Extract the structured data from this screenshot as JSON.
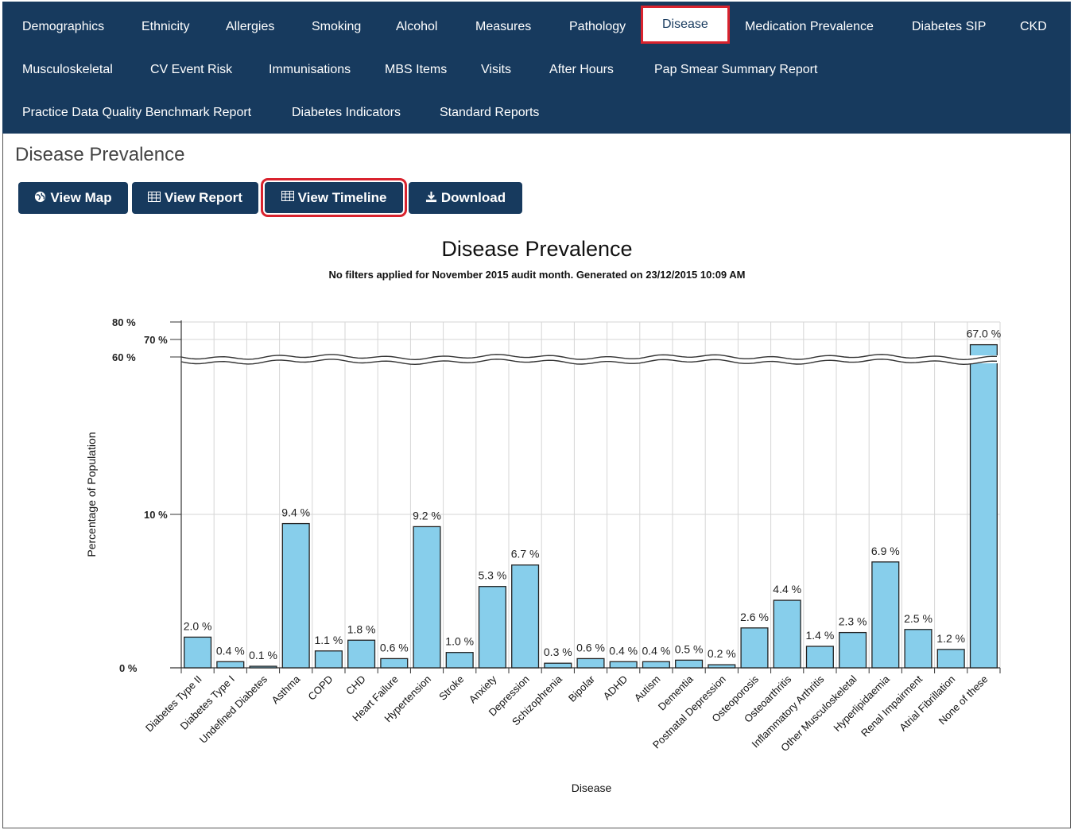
{
  "nav": {
    "row1": [
      "Demographics",
      "Ethnicity",
      "Allergies",
      "Smoking",
      "Alcohol",
      "Measures",
      "Pathology",
      "Disease",
      "Medication Prevalence",
      "Diabetes SIP",
      "CKD"
    ],
    "row2": [
      "Musculoskeletal",
      "CV Event Risk",
      "Immunisations",
      "MBS Items",
      "Visits",
      "After Hours",
      "Pap Smear Summary Report"
    ],
    "row3": [
      "Practice Data Quality Benchmark Report",
      "Diabetes Indicators",
      "Standard Reports"
    ],
    "active": "Disease"
  },
  "page": {
    "title": "Disease Prevalence"
  },
  "buttons": {
    "view_map": "View Map",
    "view_report": "View Report",
    "view_timeline": "View Timeline",
    "download": "Download"
  },
  "icons": {
    "view_map": "globe-icon",
    "view_report": "table-icon",
    "view_timeline": "table-icon",
    "download": "download-icon"
  },
  "colors": {
    "navbar": "#173a5e",
    "highlight": "#d9232e",
    "bar": "#87ceeb"
  },
  "chart_data": {
    "type": "bar",
    "title": "Disease Prevalence",
    "subtitle": "No filters applied for November 2015 audit month. Generated on 23/12/2015 10:09 AM",
    "xlabel": "Disease",
    "ylabel": "Percentage of Population",
    "y_axis_break": true,
    "yticks": [
      "0 %",
      "10 %",
      "60 %",
      "70 %",
      "80 %"
    ],
    "ylim": [
      0,
      80
    ],
    "grid": true,
    "categories": [
      "Diabetes Type II",
      "Diabetes Type I",
      "Undefined Diabetes",
      "Asthma",
      "COPD",
      "CHD",
      "Heart Failure",
      "Hypertension",
      "Stroke",
      "Anxiety",
      "Depression",
      "Schizophrenia",
      "Bipolar",
      "ADHD",
      "Autism",
      "Dementia",
      "Postnatal Depression",
      "Osteoporosis",
      "Osteoarthritis",
      "Inflammatory Arthritis",
      "Other Musculoskeletal",
      "Hyperlipidaemia",
      "Renal Impairment",
      "Atrial Fibrillation",
      "None of these"
    ],
    "values": [
      2.0,
      0.4,
      0.1,
      9.4,
      1.1,
      1.8,
      0.6,
      9.2,
      1.0,
      5.3,
      6.7,
      0.3,
      0.6,
      0.4,
      0.4,
      0.5,
      0.2,
      2.6,
      4.4,
      1.4,
      2.3,
      6.9,
      2.5,
      1.2,
      67.0
    ],
    "labels": [
      "2.0 %",
      "0.4 %",
      "0.1 %",
      "9.4 %",
      "1.1 %",
      "1.8 %",
      "0.6 %",
      "9.2 %",
      "1.0 %",
      "5.3 %",
      "6.7 %",
      "0.3 %",
      "0.6 %",
      "0.4 %",
      "0.4 %",
      "0.5 %",
      "0.2 %",
      "2.6 %",
      "4.4 %",
      "1.4 %",
      "2.3 %",
      "6.9 %",
      "2.5 %",
      "1.2 %",
      "67.0 %"
    ]
  }
}
